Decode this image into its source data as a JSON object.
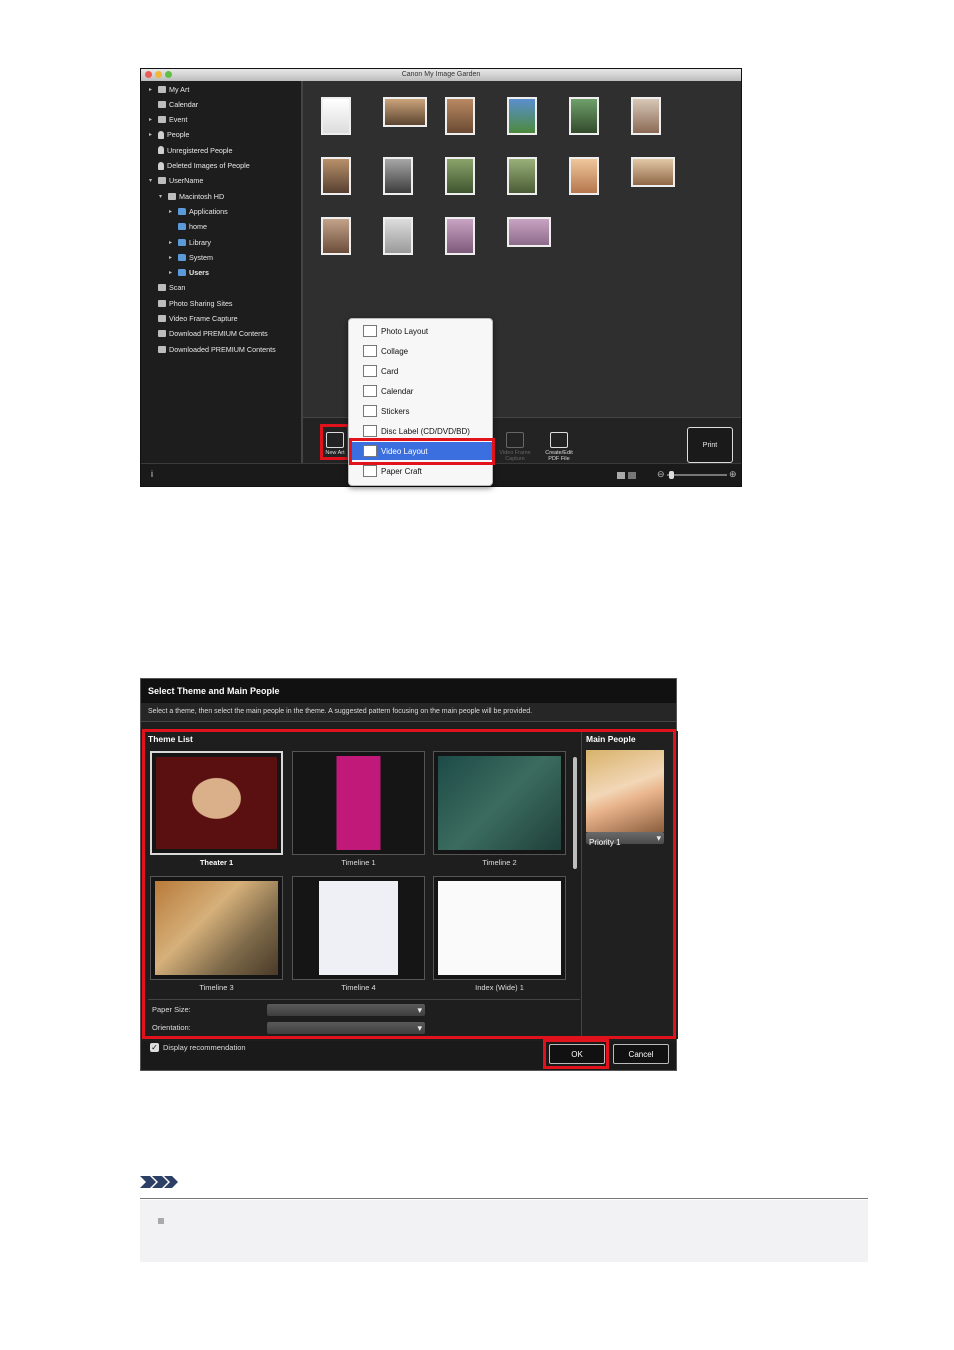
{
  "screen1": {
    "window_title": "Canon My Image Garden",
    "sidebar": [
      {
        "label": "My Art",
        "icon": "my-art-icon",
        "arrow": "▸"
      },
      {
        "label": "Calendar",
        "icon": "calendar-icon",
        "arrow": ""
      },
      {
        "label": "Event",
        "icon": "event-icon",
        "arrow": "▸"
      },
      {
        "label": "People",
        "icon": "people-icon",
        "arrow": "▸"
      },
      {
        "label": "Unregistered People",
        "icon": "unregistered-people-icon",
        "arrow": ""
      },
      {
        "label": "Deleted Images of People",
        "icon": "deleted-people-icon",
        "arrow": ""
      },
      {
        "label": "UserName",
        "icon": "computer-icon",
        "arrow": "▾"
      },
      {
        "label": "Macintosh HD",
        "icon": "hard-disk-icon",
        "arrow": "▾"
      },
      {
        "label": "Applications",
        "icon": "folder-icon",
        "arrow": "▸"
      },
      {
        "label": "home",
        "icon": "folder-icon",
        "arrow": ""
      },
      {
        "label": "Library",
        "icon": "folder-icon",
        "arrow": "▸"
      },
      {
        "label": "System",
        "icon": "folder-icon",
        "arrow": "▸"
      },
      {
        "label": "Users",
        "icon": "folder-icon",
        "arrow": "▸"
      },
      {
        "label": "Scan",
        "icon": "scan-icon",
        "arrow": ""
      },
      {
        "label": "Photo Sharing Sites",
        "icon": "photo-sharing-icon",
        "arrow": ""
      },
      {
        "label": "Video Frame Capture",
        "icon": "video-frame-icon",
        "arrow": ""
      },
      {
        "label": "Download PREMIUM Contents",
        "icon": "download-icon",
        "arrow": ""
      },
      {
        "label": "Downloaded PREMIUM Contents",
        "icon": "downloaded-icon",
        "arrow": ""
      }
    ],
    "menu": {
      "items": [
        {
          "label": "Photo Layout",
          "icon": "photo-layout-icon"
        },
        {
          "label": "Collage",
          "icon": "collage-icon"
        },
        {
          "label": "Card",
          "icon": "card-icon"
        },
        {
          "label": "Calendar",
          "icon": "calendar-icon"
        },
        {
          "label": "Stickers",
          "icon": "stickers-icon"
        },
        {
          "label": "Disc Label (CD/DVD/BD)",
          "icon": "disc-label-icon"
        },
        {
          "label": "Video Layout",
          "icon": "video-layout-icon"
        },
        {
          "label": "Paper Craft",
          "icon": "paper-craft-icon"
        }
      ],
      "selected": "Video Layout"
    },
    "toolbar": {
      "new_art": "New Art",
      "video_frame": "Video Frame Capture",
      "create_pdf": "Create/Edit PDF File",
      "print": "Print"
    },
    "status_info": "i"
  },
  "screen2": {
    "title": "Select Theme and Main People",
    "instruction": "Select a theme, then select the main people in the theme. A suggested pattern focusing on the main people will be provided.",
    "theme_list_label": "Theme List",
    "themes": [
      {
        "label": "Theater 1",
        "selected": true
      },
      {
        "label": "Timeline 1",
        "selected": false
      },
      {
        "label": "Timeline 2",
        "selected": false
      },
      {
        "label": "Timeline 3",
        "selected": false
      },
      {
        "label": "Timeline 4",
        "selected": false
      },
      {
        "label": "Index (Wide) 1",
        "selected": false
      }
    ],
    "main_people_label": "Main People",
    "priority": "Priority 1",
    "paper_size_label": "Paper Size:",
    "orientation_label": "Orientation:",
    "display_recommendation": "Display recommendation",
    "ok": "OK",
    "cancel": "Cancel"
  },
  "colors": {
    "highlight_red": "#e0121b",
    "menu_selected": "#3b6fe0"
  }
}
